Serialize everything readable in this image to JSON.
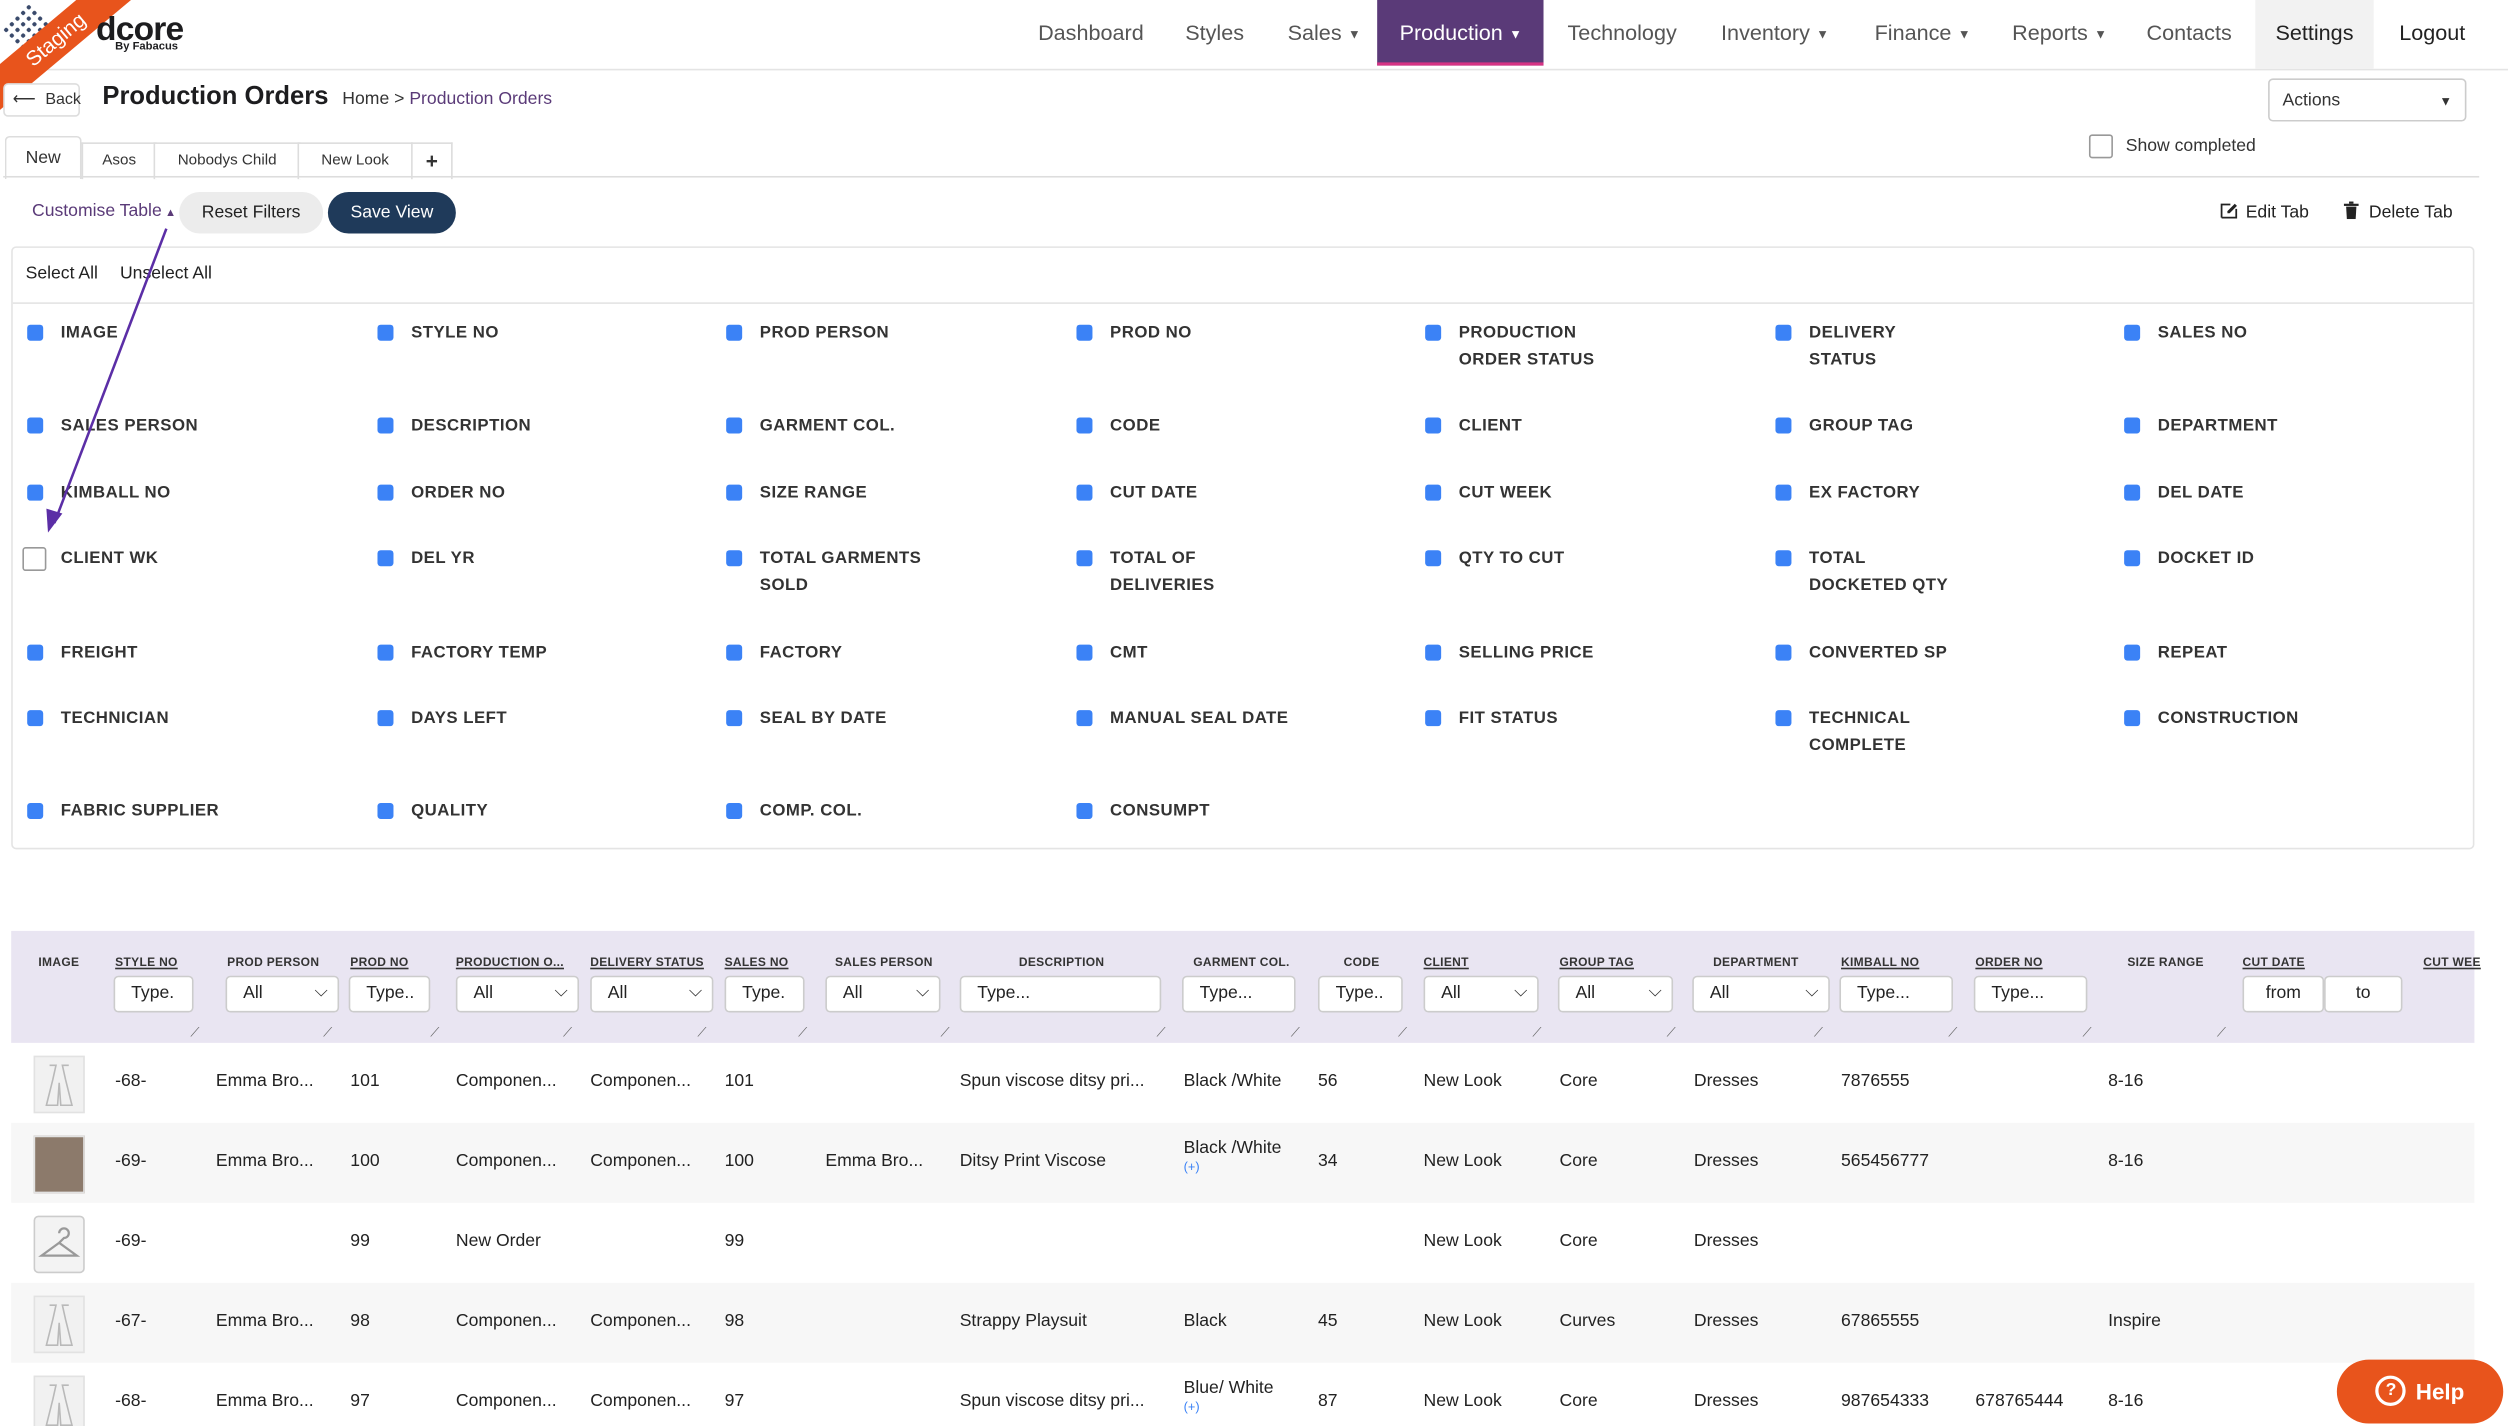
{
  "logo": {
    "brand": "dcore",
    "sub": "By Fabacus",
    "badge": "Staging"
  },
  "nav": {
    "items": [
      {
        "label": "Dashboard",
        "caret": false
      },
      {
        "label": "Styles",
        "caret": false
      },
      {
        "label": "Sales",
        "caret": true
      },
      {
        "label": "Production",
        "caret": true
      },
      {
        "label": "Technology",
        "caret": false
      },
      {
        "label": "Inventory",
        "caret": true
      },
      {
        "label": "Finance",
        "caret": true
      },
      {
        "label": "Reports",
        "caret": true
      },
      {
        "label": "Contacts",
        "caret": false
      }
    ],
    "settings": "Settings",
    "logout": "Logout"
  },
  "header": {
    "back": "Back",
    "title": "Production Orders",
    "breadcrumb": {
      "home": "Home",
      "sep": ">",
      "current": "Production Orders"
    },
    "actions": "Actions"
  },
  "tabs": [
    "New",
    "Asos",
    "Nobodys Child",
    "New Look",
    "+"
  ],
  "show_completed": "Show completed",
  "toolbar": {
    "customise": "Customise Table",
    "reset": "Reset Filters",
    "save": "Save View",
    "edit_tab": "Edit Tab",
    "delete_tab": "Delete Tab"
  },
  "picker": {
    "select_all": "Select All",
    "unselect_all": "Unselect All",
    "rows": [
      [
        "IMAGE",
        "STYLE NO",
        "PROD PERSON",
        "PROD NO",
        "PRODUCTION ORDER STATUS",
        "DELIVERY STATUS",
        "SALES NO"
      ],
      [
        "SALES PERSON",
        "DESCRIPTION",
        "GARMENT COL.",
        "CODE",
        "CLIENT",
        "GROUP TAG",
        "DEPARTMENT"
      ],
      [
        "KIMBALL NO",
        "ORDER NO",
        "SIZE RANGE",
        "CUT DATE",
        "CUT WEEK",
        "EX FACTORY",
        "DEL DATE"
      ],
      [
        "CLIENT WK",
        "DEL YR",
        "TOTAL GARMENTS SOLD",
        "TOTAL OF DELIVERIES",
        "QTY TO CUT",
        "TOTAL DOCKETED QTY",
        "DOCKET ID"
      ],
      [
        "FREIGHT",
        "FACTORY TEMP",
        "FACTORY",
        "CMT",
        "SELLING PRICE",
        "CONVERTED SP",
        "REPEAT"
      ],
      [
        "TECHNICIAN",
        "DAYS LEFT",
        "SEAL BY DATE",
        "MANUAL SEAL DATE",
        "FIT STATUS",
        "TECHNICAL COMPLETE",
        "CONSTRUCTION"
      ],
      [
        "FABRIC SUPPLIER",
        "QUALITY",
        "COMP. COL.",
        "CONSUMPT"
      ]
    ],
    "unchecked": [
      "CLIENT WK"
    ]
  },
  "table": {
    "headers": [
      "IMAGE",
      "STYLE NO",
      "PROD PERSON",
      "PROD NO",
      "PRODUCTION O...",
      "DELIVERY STATUS",
      "SALES NO",
      "SALES PERSON",
      "DESCRIPTION",
      "GARMENT COL.",
      "CODE",
      "CLIENT",
      "GROUP TAG",
      "DEPARTMENT",
      "KIMBALL NO",
      "ORDER NO",
      "SIZE RANGE",
      "CUT DATE",
      "CUT WEE"
    ],
    "filters": {
      "style_no": "Type.",
      "prod_person": "All",
      "prod_no": "Type..",
      "prod_order": "All",
      "delivery": "All",
      "sales_no": "Type.",
      "sales_person": "All",
      "description": "Type...",
      "garment": "Type...",
      "code": "Type..",
      "client": "All",
      "group": "All",
      "department": "All",
      "kimball": "Type...",
      "order": "Type...",
      "cut_from": "from",
      "cut_to": "to"
    },
    "rows": [
      {
        "style": "-68-",
        "person": "Emma Bro...",
        "prod_no": "101",
        "status": "Componen...",
        "delivery": "Componen...",
        "sales_no": "101",
        "sales_person": "",
        "description": "Spun viscose ditsy pri...",
        "colour": "Black /White",
        "colour_plus": "",
        "code": "56",
        "client": "New Look",
        "group": "Core",
        "dept": "Dresses",
        "kimball": "7876555",
        "order": "",
        "size": "8-16"
      },
      {
        "style": "-69-",
        "person": "Emma Bro...",
        "prod_no": "100",
        "status": "Componen...",
        "delivery": "Componen...",
        "sales_no": "100",
        "sales_person": "Emma Bro...",
        "description": "Ditsy Print Viscose",
        "colour": "Black /White",
        "colour_plus": "(+)",
        "code": "34",
        "client": "New Look",
        "group": "Core",
        "dept": "Dresses",
        "kimball": "565456777",
        "order": "",
        "size": "8-16"
      },
      {
        "style": "-69-",
        "person": "",
        "prod_no": "99",
        "status": "New Order",
        "delivery": "",
        "sales_no": "99",
        "sales_person": "",
        "description": "",
        "colour": "",
        "colour_plus": "",
        "code": "",
        "client": "New Look",
        "group": "Core",
        "dept": "Dresses",
        "kimball": "",
        "order": "",
        "size": ""
      },
      {
        "style": "-67-",
        "person": "Emma Bro...",
        "prod_no": "98",
        "status": "Componen...",
        "delivery": "Componen...",
        "sales_no": "98",
        "sales_person": "",
        "description": "Strappy Playsuit",
        "colour": "Black",
        "colour_plus": "",
        "code": "45",
        "client": "New Look",
        "group": "Curves",
        "dept": "Dresses",
        "kimball": "67865555",
        "order": "",
        "size": "Inspire"
      },
      {
        "style": "-68-",
        "person": "Emma Bro...",
        "prod_no": "97",
        "status": "Componen...",
        "delivery": "Componen...",
        "sales_no": "97",
        "sales_person": "",
        "description": "Spun viscose ditsy pri...",
        "colour": "Blue/ White",
        "colour_plus": "(+)",
        "code": "87",
        "client": "New Look",
        "group": "Core",
        "dept": "Dresses",
        "kimball": "987654333",
        "order": "678765444",
        "size": "8-16"
      }
    ]
  },
  "help": "Help",
  "colors": {
    "accent": "#5a3a78",
    "nav_active": "#5a3a78",
    "save_btn": "#1f3a5a",
    "checkbox": "#3b82f6",
    "header_bg": "#e9e5f2",
    "help": "#e8541c",
    "arrow": "#5b2ea6"
  }
}
